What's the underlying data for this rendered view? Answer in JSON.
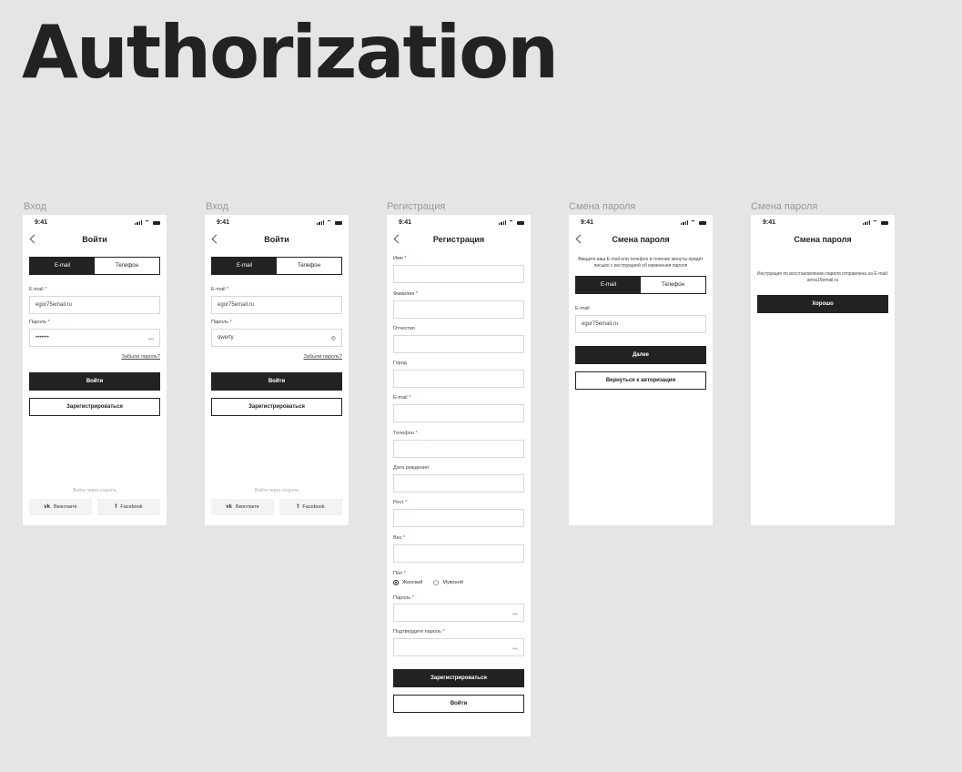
{
  "board": {
    "title": "Authorization"
  },
  "status": {
    "time": "9:41"
  },
  "login1": {
    "frame_label": "Вход",
    "header": "Войти",
    "tabs": [
      "E-mail",
      "Телефон"
    ],
    "email_label": "E-mail",
    "email_value": "egor75email.ru",
    "password_label": "Пароль",
    "password_value": "•••••••",
    "forgot": "Забыли пароль?",
    "login_btn": "Войти",
    "register_btn": "Зарегистрироваться",
    "social_caption": "Войти через соцсеть",
    "vk": "Вконтакте",
    "fb": "Facebook"
  },
  "login2": {
    "frame_label": "Вход",
    "header": "Войти",
    "tabs": [
      "E-mail",
      "Телефон"
    ],
    "email_label": "E-mail",
    "email_value": "egor75email.ru",
    "password_label": "Пароль",
    "password_value": "qwerty",
    "forgot": "Забыли пароль?",
    "login_btn": "Войти",
    "register_btn": "Зарегистрироваться",
    "social_caption": "Войти через соцсеть",
    "vk": "Вконтакте",
    "fb": "Facebook"
  },
  "register": {
    "frame_label": "Регистрация",
    "header": "Регистрация",
    "fields": [
      "Имя",
      "Фамилия",
      "Отчество",
      "Город",
      "E-mail",
      "Телефон",
      "Дата рождения",
      "Рост",
      "Вес"
    ],
    "gender_label": "Пол",
    "gender_options": [
      "Женский",
      "Мужской"
    ],
    "password_label": "Пароль",
    "confirm_label": "Подтвердите пароль",
    "register_btn": "Зарегистрироваться",
    "login_btn": "Войти"
  },
  "reset1": {
    "frame_label": "Смена пароля",
    "header": "Смена пароля",
    "note": "Введите ваш E-mail или телефон в течение минуты придёт письмо с инструкцией об изменении пароля",
    "tabs": [
      "E-mail",
      "Телефон"
    ],
    "email_label": "E-mail",
    "email_value": "egor75email.ru",
    "next_btn": "Далее",
    "back_btn": "Вернуться к авторизации"
  },
  "reset2": {
    "frame_label": "Смена пароля",
    "header": "Смена пароля",
    "note": "Инструкция по восстановлению пароля отправлена на E-mail: anna15email.ru",
    "ok_btn": "Хорошо"
  }
}
